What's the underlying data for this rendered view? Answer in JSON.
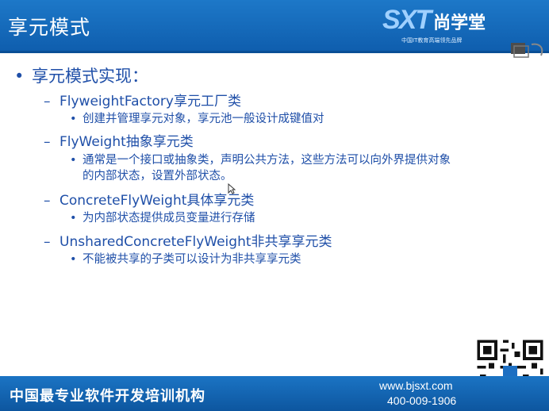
{
  "header": {
    "title": "享元模式",
    "logo_mark": "SXT",
    "logo_brand": "尚学堂",
    "logo_tagline": "中国IT教育高端领先品牌"
  },
  "content": {
    "heading": "享元模式实现：",
    "items": [
      {
        "label": "FlyweightFactory享元工厂类",
        "details": [
          "创建并管理享元对象，享元池一般设计成键值对"
        ]
      },
      {
        "label": "FlyWeight抽象享元类",
        "details": [
          "通常是一个接口或抽象类，声明公共方法，这些方法可以向外界提供对象",
          "的内部状态，设置外部状态。"
        ]
      },
      {
        "label": "ConcreteFlyWeight具体享元类",
        "details": [
          "为内部状态提供成员变量进行存储"
        ]
      },
      {
        "label": "UnsharedConcreteFlyWeight非共享享元类",
        "details": [
          "不能被共享的子类可以设计为非共享享元类"
        ]
      }
    ]
  },
  "footer": {
    "slogan": "中国最专业软件开发培训机构",
    "website": "www.bjsxt.com",
    "phone": "400-009-1906"
  },
  "colors": {
    "header_blue": "#1466b8",
    "text_blue": "#1f4fa8",
    "footer_blue": "#0d569f"
  },
  "icons": [
    "slide-icon",
    "qr-code-icon",
    "mouse-cursor-icon"
  ]
}
